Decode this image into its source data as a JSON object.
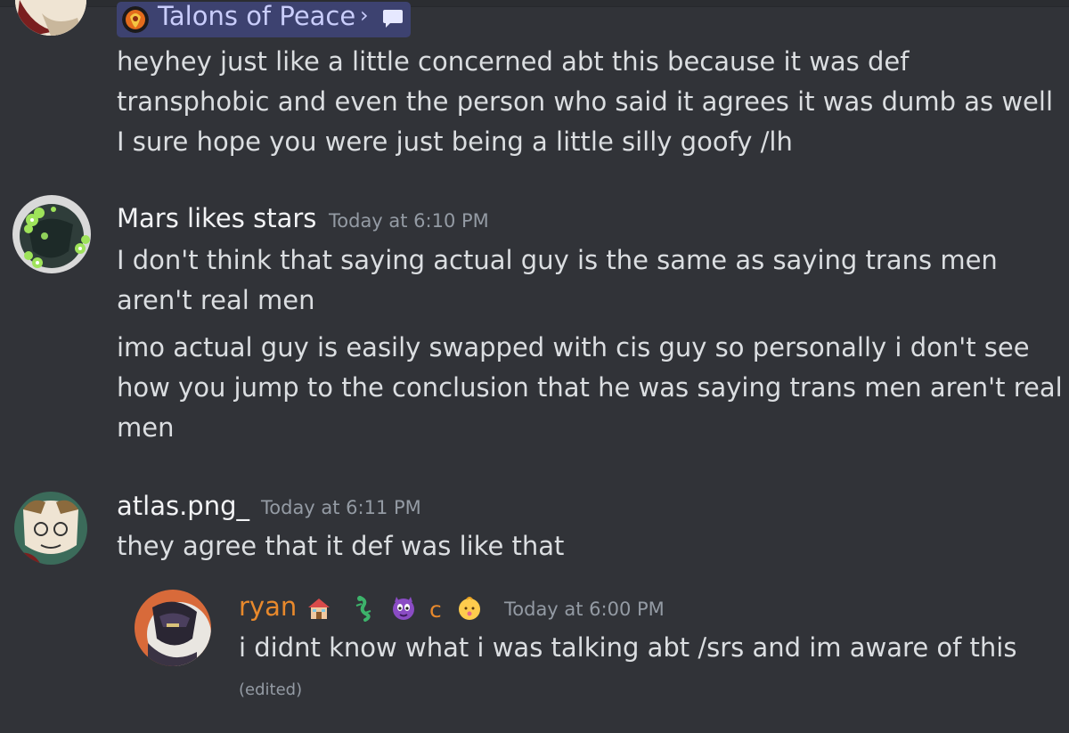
{
  "thread": {
    "forum_name": "Talons of Peace",
    "chevron": "›"
  },
  "messages": [
    {
      "lines": [
        "heyhey just like a little concerned abt this because it was def",
        "transphobic and even the person who said it agrees it was dumb as well",
        "I sure hope you were just being a little silly goofy /lh"
      ]
    },
    {
      "username": "Mars likes stars",
      "timestamp": "Today at 6:10 PM",
      "lines": [
        "I don't think that saying actual guy is the same as saying trans men",
        "aren't real men",
        "imo actual guy is easily swapped with cis guy so personally i don't see",
        "how you jump to the conclusion that he was saying trans men aren't real",
        "men"
      ]
    },
    {
      "username": "atlas.png_",
      "timestamp": "Today at 6:11 PM",
      "lines": [
        "they agree that it def was like that"
      ]
    },
    {
      "username": "ryan",
      "username_color": "#e8892c",
      "role_letter": "c",
      "timestamp": "Today at 6:00 PM",
      "lines": [
        "i didnt know what i was talking abt /srs and im aware of this"
      ],
      "edited": "(edited)"
    }
  ],
  "colors": {
    "background": "#313338",
    "text": "#dbdee1",
    "muted": "#949ba4",
    "forum_chip": "#3d4270"
  },
  "icons": [
    "forum-favicon-icon",
    "chevron-right-icon",
    "thread-bubble-icon",
    "house-emoji-icon",
    "lizard-emoji-icon",
    "devil-emoji-icon",
    "baby-emoji-icon"
  ]
}
